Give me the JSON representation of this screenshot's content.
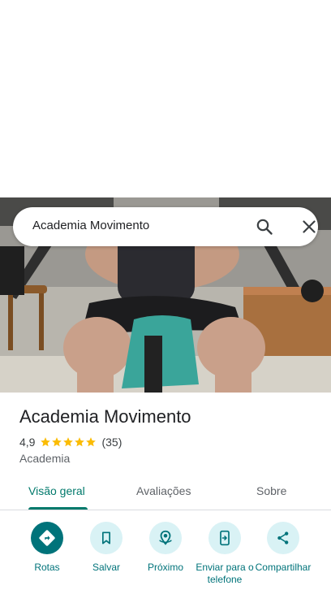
{
  "search": {
    "query": "Academia Movimento"
  },
  "place": {
    "title": "Academia Movimento",
    "rating": "4,9",
    "stars": 5,
    "review_count": "(35)",
    "category": "Academia"
  },
  "tabs": [
    {
      "label": "Visão geral",
      "active": true
    },
    {
      "label": "Avaliações",
      "active": false
    },
    {
      "label": "Sobre",
      "active": false
    }
  ],
  "actions": [
    {
      "label": "Rotas",
      "icon": "directions-icon"
    },
    {
      "label": "Salvar",
      "icon": "bookmark-icon"
    },
    {
      "label": "Próximo",
      "icon": "nearby-icon"
    },
    {
      "label": "Enviar para o telefone",
      "icon": "send-to-phone-icon"
    },
    {
      "label": "Compartilhar",
      "icon": "share-icon"
    }
  ],
  "colors": {
    "accent": "#00737a",
    "accent_light": "#d9f2f5",
    "star": "#fbbc04"
  }
}
